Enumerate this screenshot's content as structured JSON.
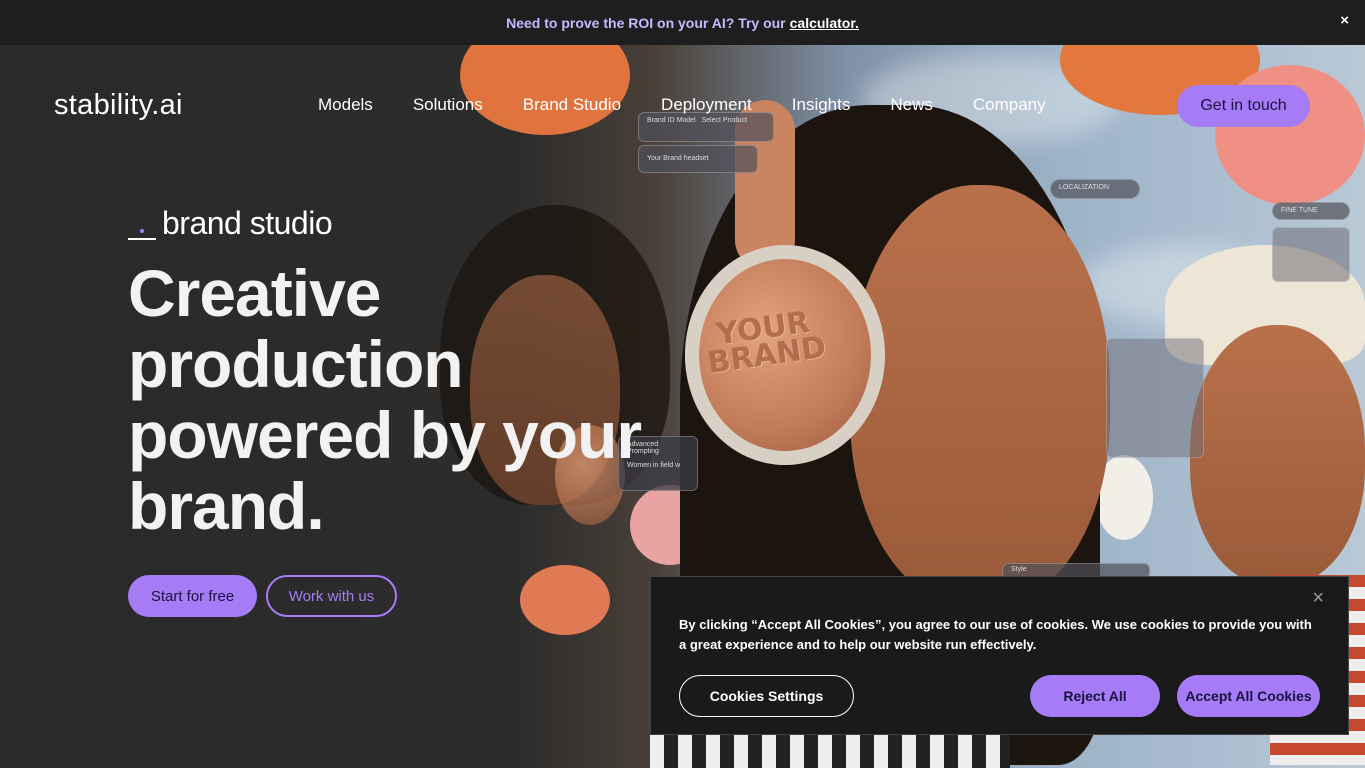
{
  "announcement": {
    "text": "Need to prove the ROI on your AI? Try our",
    "link": "calculator.",
    "close": "×"
  },
  "nav": {
    "logo": "stability.ai",
    "links": [
      "Models",
      "Solutions",
      "Brand Studio",
      "Deployment",
      "Insights",
      "News",
      "Company"
    ],
    "cta": "Get in touch"
  },
  "hero": {
    "eyebrow": "brand studio",
    "headline": "Creative production powered by your brand.",
    "primary_button": "Start for free",
    "secondary_button": "Work with us",
    "engraving": "YOUR BRAND",
    "ui_chips": {
      "brand_id": "Brand ID Model",
      "select_product": "Select Product",
      "your_brand_headset": "Your Brand headset",
      "localization": "LOCALIZATION",
      "fine_tune": "FINE TUNE",
      "advanced_prompting": "Advanced Prompting",
      "women_in_field": "Women in field w",
      "style": "Style"
    }
  },
  "cookie_banner": {
    "close": "×",
    "text": "By clicking “Accept All Cookies”, you agree to our use of cookies. We use cookies to provide you with a great experience and to help our website run effectively.",
    "settings": "Cookies Settings",
    "reject": "Reject All",
    "accept": "Accept All Cookies"
  },
  "colors": {
    "accent": "#a67cf6",
    "banner_bg": "#1e1e1e",
    "hero_dark": "#2a2a2a"
  }
}
